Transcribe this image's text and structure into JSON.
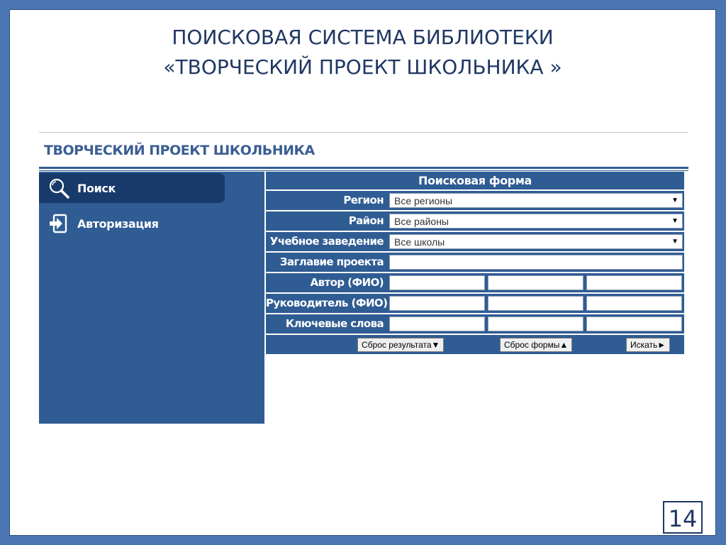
{
  "slide": {
    "title_line1": "ПОИСКОВАЯ СИСТЕМА БИБЛИОТЕКИ",
    "title_line2": "«ТВОРЧЕСКИЙ ПРОЕКТ ШКОЛЬНИКА »",
    "page_number": "14"
  },
  "site": {
    "title": "ТВОРЧЕСКИЙ ПРОЕКТ ШКОЛЬНИКА"
  },
  "sidebar": {
    "items": [
      {
        "label": "Поиск",
        "icon": "search-icon",
        "active": true
      },
      {
        "label": "Авторизация",
        "icon": "login-icon",
        "active": false
      }
    ]
  },
  "form": {
    "header": "Поисковая форма",
    "region_label": "Регион",
    "region_value": "Все регионы",
    "district_label": "Район",
    "district_value": "Все районы",
    "school_label": "Учебное заведение",
    "school_value": "Все школы",
    "project_title_label": "Заглавие проекта",
    "author_label": "Автор (ФИО)",
    "supervisor_label": "Руководитель (ФИО)",
    "keywords_label": "Ключевые слова",
    "buttons": {
      "reset_results": "Сброс результата▼",
      "reset_form": "Сброс формы▲",
      "search": "Искать►"
    }
  },
  "colors": {
    "frame": "#4a77b4",
    "panel": "#2f5c93",
    "active_nav": "#183a6a",
    "title": "#1f3763"
  }
}
